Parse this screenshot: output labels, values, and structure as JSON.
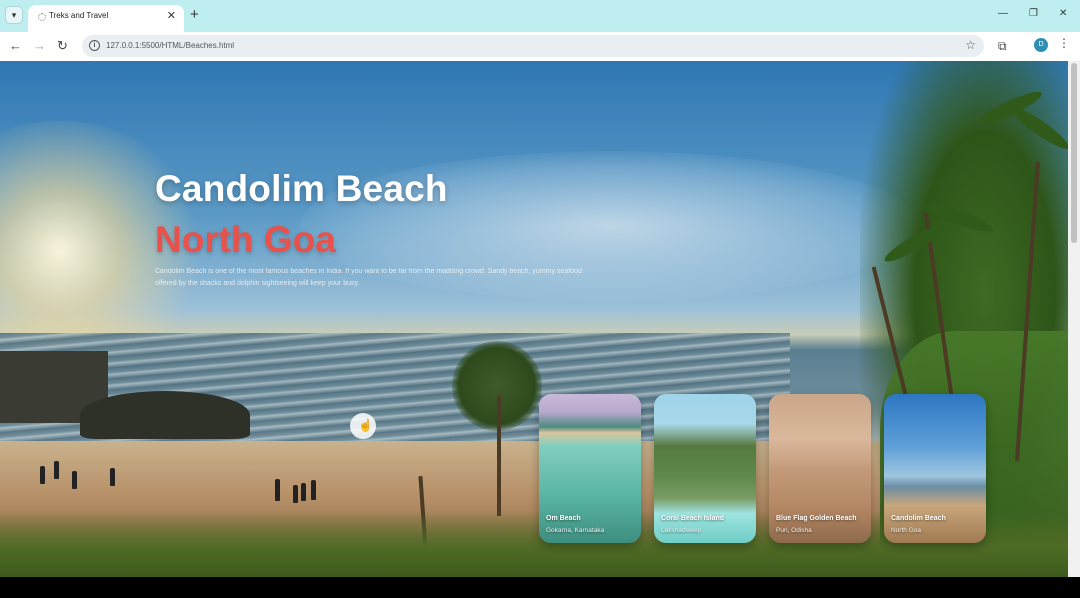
{
  "browser": {
    "tab_title": "Treks and Travel",
    "url": "127.0.0.1:5500/HTML/Beaches.html",
    "profile_initial": "D",
    "icons": {
      "tab_menu": "chevron-down-icon",
      "tab_close": "close-icon",
      "new_tab": "plus-icon",
      "back": "back-arrow-icon",
      "forward": "forward-arrow-icon",
      "reload": "reload-icon",
      "site_info": "info-icon",
      "bookmark": "star-icon",
      "extensions": "puzzle-icon",
      "menu": "kebab-icon"
    }
  },
  "hero": {
    "title": "Candolim Beach",
    "subtitle": "North Goa",
    "description": "Candolim Beach is one of the most famous beaches in India. If you want to be far from the madding crowd. Sandy beach, yummy seafood offered by the shacks and dolphin sightseeing will keep your busy."
  },
  "cards": [
    {
      "name": "Om Beach",
      "location": "Gokarna, Karnataka"
    },
    {
      "name": "Coral Beach Island",
      "location": "Lakshadweep"
    },
    {
      "name": "Blue Flag Golden Beach",
      "location": "Puri, Odisha"
    },
    {
      "name": "Candolim Beach",
      "location": "North Goa"
    }
  ],
  "colors": {
    "accent": "#e8524a",
    "tabbar": "#bfeef0"
  }
}
